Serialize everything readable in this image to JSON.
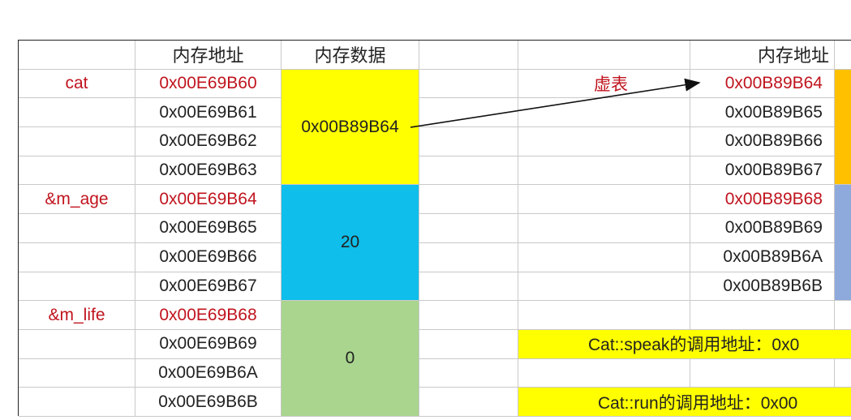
{
  "headers": {
    "addr": "内存地址",
    "data": "内存数据",
    "vtable_addr": "内存地址"
  },
  "labels": {
    "cat": "cat",
    "m_age": "&m_age",
    "m_life": "&m_life",
    "vtable": "虚表"
  },
  "addresses": [
    "0x00E69B60",
    "0x00E69B61",
    "0x00E69B62",
    "0x00E69B63",
    "0x00E69B64",
    "0x00E69B65",
    "0x00E69B66",
    "0x00E69B67",
    "0x00E69B68",
    "0x00E69B69",
    "0x00E69B6A",
    "0x00E69B6B"
  ],
  "memory_data": {
    "vptr": "0x00B89B64",
    "age": "20",
    "life": "0"
  },
  "vtable_addresses": [
    "0x00B89B64",
    "0x00B89B65",
    "0x00B89B66",
    "0x00B89B67",
    "0x00B89B68",
    "0x00B89B69",
    "0x00B89B6A",
    "0x00B89B6B"
  ],
  "call_addresses": {
    "speak": "Cat::speak的调用地址：0x0",
    "run": "Cat::run的调用地址：0x00"
  },
  "colors": {
    "vptr_block": "#ffff00",
    "age_block": "#0fbeea",
    "life_block": "#a9d58e",
    "red_text": "#c0141e",
    "vtable_col_top": "#ffc000",
    "vtable_col_bottom": "#8ea9db"
  }
}
